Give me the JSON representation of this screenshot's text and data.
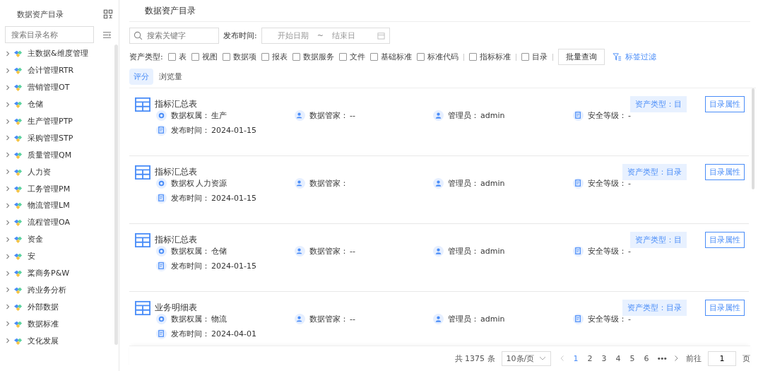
{
  "sidebar": {
    "title": "数据资产目录",
    "search": {
      "placeholder": "搜索目录名称"
    },
    "items": [
      {
        "label": "主数据&维度管理",
        "expanded": false
      },
      {
        "label": "会计管理RTR",
        "expanded": false
      },
      {
        "label": "营销管理OT",
        "expanded": false
      },
      {
        "label": "仓储",
        "expanded": false
      },
      {
        "label": "生产管理PTP",
        "expanded": false
      },
      {
        "label": "采购管理STP",
        "expanded": false
      },
      {
        "label": "质量管理QM",
        "expanded": false
      },
      {
        "label": "人力资",
        "expanded": false
      },
      {
        "label": "工务管理PM",
        "expanded": false
      },
      {
        "label": "物流管理LM",
        "expanded": false
      },
      {
        "label": "流程管理OA",
        "expanded": false
      },
      {
        "label": "资金",
        "expanded": false
      },
      {
        "label": "安",
        "expanded": false
      },
      {
        "label": "桨商务P&W",
        "expanded": false
      },
      {
        "label": "跨业务分析",
        "expanded": false
      },
      {
        "label": "外部数据",
        "expanded": false
      },
      {
        "label": "数据标准",
        "expanded": false
      },
      {
        "label": "文化发展",
        "expanded": false
      }
    ]
  },
  "page_title": "数据资产目录",
  "filters": {
    "search": {
      "placeholder": "搜索关键字"
    },
    "date_label": "发布时间:",
    "start_placeholder": "开始日期",
    "separator": "~",
    "end_placeholder": "结束日",
    "type_label": "资产类型:",
    "type_groups": [
      {
        "items": [
          {
            "label": "表",
            "checked": false
          },
          {
            "label": "视图",
            "checked": false
          },
          {
            "label": "数据项",
            "checked": false
          },
          {
            "label": "报表",
            "checked": false
          },
          {
            "label": "数据服务",
            "checked": false
          },
          {
            "label": "文件",
            "checked": false
          },
          {
            "label": "基础标准",
            "checked": false
          },
          {
            "label": "标准代码",
            "checked": false
          }
        ]
      },
      {
        "items": [
          {
            "label": "指标标准",
            "checked": false
          }
        ]
      },
      {
        "items": [
          {
            "label": "目录",
            "checked": false
          }
        ]
      }
    ],
    "batch_button": "批量查询",
    "tag_filter": "标签过滤"
  },
  "sort_tabs": [
    {
      "label": "评分",
      "selected": true
    },
    {
      "label": "浏览量",
      "selected": false
    }
  ],
  "cards": [
    {
      "title": "指标汇总表",
      "owner_label": "数据权属：",
      "owner": "生产",
      "steward_label": "数据管家：",
      "steward": "--",
      "admin_label": "管理员：",
      "admin": "admin",
      "security_label": "安全等级：",
      "security": "-",
      "date_label": "发布时间：",
      "date": "2024-01-15",
      "tag": "资产类型：目",
      "button": "目录属性"
    },
    {
      "title": "指标汇总表",
      "owner_label": "数据权",
      "owner": "人力资源",
      "steward_label": "数据管家：",
      "admin_label": "管理员：",
      "admin": "admin",
      "security_label": "安全等级：",
      "security": "-",
      "date_label": "发布时间：",
      "date": "2024-01-15",
      "tag": "资产类型：目录",
      "button": "目录属性"
    },
    {
      "title": "指标汇总表",
      "owner_label": "数据权属：",
      "owner": "仓储",
      "steward_label": "数据管家：",
      "steward": "--",
      "admin_label": "管理员：",
      "admin": "admin",
      "security_label": "安全等级：",
      "security": "-",
      "date_label": "发布时间：",
      "date": "2024-01-15",
      "tag": "资产类型：目",
      "button": "目录属性"
    },
    {
      "title": "业务明细表",
      "owner_label": "数据权属：",
      "owner": "物流",
      "steward_label": "数据管家：",
      "steward": "--",
      "admin_label": "管理员：",
      "admin": "admin",
      "security_label": "安全等级：",
      "security": "-",
      "date_label": "发布时间：",
      "date": "2024-04-01",
      "tag": "资产类型：目录",
      "button": "目录属性"
    }
  ],
  "pagination": {
    "total": "共 1375 条",
    "page_size": "10条/页",
    "pages": [
      {
        "label": "1",
        "selected": true
      },
      {
        "label": "2",
        "selected": false
      },
      {
        "label": "3",
        "selected": false
      },
      {
        "label": "4",
        "selected": false
      },
      {
        "label": "5",
        "selected": false
      },
      {
        "label": "6",
        "selected": false
      }
    ],
    "more": "•••",
    "goto_label": "前往",
    "goto_value": "1",
    "page_unit": "页"
  }
}
